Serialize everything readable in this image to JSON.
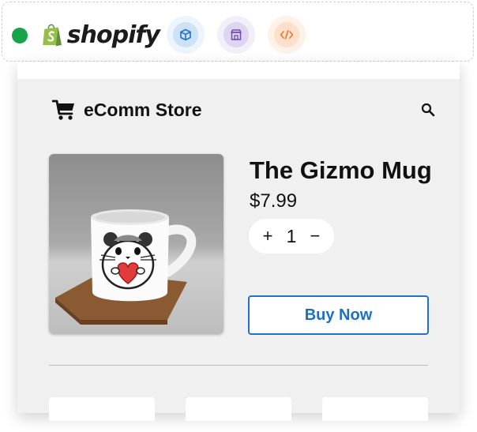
{
  "toolbar": {
    "status_color": "#16a34a",
    "brand": {
      "name": "shopify",
      "icon": "shopify-bag-icon",
      "bag_color": "#95bf47"
    },
    "tools": [
      {
        "icon": "box-icon",
        "color": "#1f73c4"
      },
      {
        "icon": "storefront-icon",
        "color": "#6d4bb5"
      },
      {
        "icon": "code-icon",
        "color": "#e67a2e"
      }
    ]
  },
  "store": {
    "cart_icon": "cart-icon",
    "name": "eComm Store",
    "search_icon": "search-icon"
  },
  "product": {
    "image": "mug-with-hamster-heart",
    "title": "The Gizmo Mug",
    "price": "$7.99",
    "quantity": {
      "increment_label": "+",
      "value": "1",
      "decrement_label": "−"
    },
    "buy_label": "Buy Now",
    "accent_color": "#1f73c4"
  },
  "related": {
    "card_count": 3
  }
}
